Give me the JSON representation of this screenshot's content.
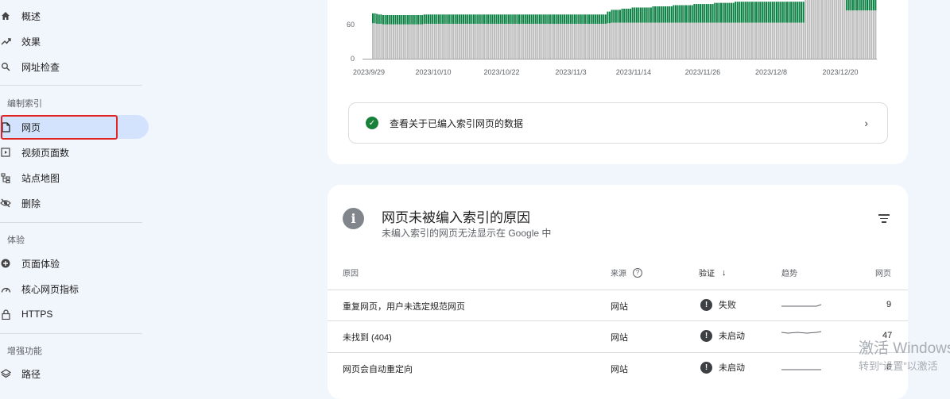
{
  "sidebar": {
    "items": [
      {
        "label": "概述",
        "icon": "home-icon"
      },
      {
        "label": "效果",
        "icon": "trending-icon"
      },
      {
        "label": "网址检查",
        "icon": "search-icon"
      }
    ],
    "sections": [
      {
        "label": "编制索引",
        "items": [
          {
            "label": "网页",
            "icon": "page-icon",
            "active": true
          },
          {
            "label": "视频页面数",
            "icon": "video-page-icon"
          },
          {
            "label": "站点地图",
            "icon": "sitemap-icon"
          },
          {
            "label": "删除",
            "icon": "hide-icon"
          }
        ]
      },
      {
        "label": "体验",
        "items": [
          {
            "label": "页面体验",
            "icon": "add-circle-icon"
          },
          {
            "label": "核心网页指标",
            "icon": "speed-icon"
          },
          {
            "label": "HTTPS",
            "icon": "lock-icon"
          }
        ]
      },
      {
        "label": "增强功能",
        "items": [
          {
            "label": "路径",
            "icon": "layers-icon"
          }
        ]
      }
    ]
  },
  "chart_data": {
    "type": "bar",
    "stacked": true,
    "y_ticks": [
      "60",
      "0"
    ],
    "x_ticks": [
      "2023/9/29",
      "2023/10/10",
      "2023/10/22",
      "2023/11/3",
      "2023/11/14",
      "2023/11/26",
      "2023/12/8",
      "2023/12/20"
    ],
    "series": [
      {
        "color": "#bdbdbd",
        "values": [
          61,
          61,
          60,
          60,
          60,
          59,
          59,
          59,
          59,
          59,
          59,
          59,
          59,
          59,
          59,
          59,
          59,
          59,
          59,
          59,
          59,
          59,
          59,
          59,
          59,
          60,
          60,
          60,
          60,
          60,
          60,
          60,
          60,
          60,
          60,
          60,
          60,
          60,
          60,
          60,
          60,
          60,
          60,
          60,
          60,
          60,
          60,
          60,
          60,
          60,
          60,
          60,
          60,
          60,
          60,
          60,
          60,
          60,
          60,
          60,
          60,
          60,
          60,
          60,
          60,
          60,
          60,
          60,
          60,
          60,
          60,
          60,
          60,
          60,
          60,
          60,
          60,
          60,
          60,
          60,
          60,
          60,
          60,
          60,
          60,
          60,
          60,
          60,
          60,
          60,
          60,
          60,
          60,
          60,
          60,
          60,
          60,
          60,
          60,
          60,
          60,
          60,
          60,
          60,
          60,
          60,
          60,
          60,
          60,
          60,
          60,
          60,
          60,
          60,
          61,
          61,
          62,
          62,
          62,
          62,
          62,
          62,
          62,
          62,
          62,
          62,
          62,
          62,
          62,
          62,
          62,
          62,
          62,
          62,
          62,
          62,
          62,
          62,
          62,
          62,
          62,
          62,
          62,
          62,
          62,
          62,
          62,
          62,
          62,
          62,
          62,
          62,
          62,
          62,
          62,
          62,
          62,
          62,
          62,
          62,
          62,
          62,
          62,
          62,
          62,
          62,
          62,
          62,
          62,
          62,
          62,
          62,
          62,
          62,
          62,
          62,
          62,
          62,
          62,
          62,
          62,
          62,
          62,
          62,
          62,
          62,
          62,
          62,
          62,
          62,
          62,
          62,
          62,
          62,
          62,
          62,
          62,
          62,
          62,
          62,
          62,
          62,
          62,
          62,
          62,
          62,
          62,
          62,
          62,
          62,
          110,
          110,
          110,
          110,
          110,
          110,
          110,
          110,
          110,
          110,
          110,
          110,
          110,
          110,
          110,
          110,
          110,
          110,
          110,
          110,
          83,
          83,
          83,
          83,
          83,
          83,
          83,
          83,
          83,
          83,
          83,
          83,
          83,
          83,
          83
        ]
      },
      {
        "color": "#0b8043",
        "values": [
          17,
          17,
          17,
          16,
          16,
          16,
          16,
          16,
          16,
          16,
          16,
          16,
          16,
          16,
          16,
          16,
          16,
          16,
          16,
          16,
          16,
          16,
          16,
          16,
          16,
          16,
          16,
          16,
          16,
          16,
          16,
          16,
          16,
          16,
          16,
          16,
          16,
          16,
          16,
          16,
          16,
          16,
          16,
          16,
          16,
          16,
          16,
          16,
          16,
          16,
          16,
          16,
          16,
          16,
          16,
          16,
          16,
          16,
          16,
          16,
          16,
          16,
          16,
          16,
          16,
          16,
          16,
          16,
          16,
          16,
          16,
          16,
          16,
          16,
          16,
          16,
          16,
          16,
          16,
          16,
          16,
          16,
          16,
          16,
          16,
          16,
          16,
          16,
          16,
          16,
          16,
          16,
          16,
          16,
          16,
          16,
          16,
          16,
          16,
          16,
          16,
          16,
          16,
          16,
          16,
          16,
          16,
          16,
          16,
          16,
          16,
          16,
          16,
          16,
          20,
          20,
          22,
          22,
          22,
          22,
          22,
          24,
          24,
          24,
          24,
          24,
          26,
          26,
          26,
          26,
          26,
          26,
          26,
          26,
          26,
          26,
          28,
          28,
          28,
          28,
          28,
          28,
          28,
          28,
          28,
          28,
          30,
          30,
          30,
          30,
          30,
          30,
          30,
          30,
          30,
          30,
          32,
          32,
          32,
          32,
          32,
          32,
          32,
          32,
          32,
          32,
          34,
          34,
          34,
          34,
          34,
          34,
          34,
          34,
          34,
          34,
          36,
          36,
          36,
          36,
          36,
          36,
          36,
          36,
          36,
          36,
          36,
          36,
          36,
          36,
          36,
          36,
          36,
          36,
          36,
          36,
          36,
          36,
          36,
          36,
          36,
          36,
          36,
          36,
          36,
          36,
          36,
          36,
          36,
          36,
          0,
          0,
          0,
          0,
          0,
          0,
          0,
          0,
          0,
          0,
          0,
          0,
          0,
          0,
          0,
          0,
          0,
          0,
          0,
          0,
          28,
          28,
          28,
          28,
          28,
          28,
          28,
          28,
          28,
          28,
          28,
          28,
          28,
          28,
          28
        ]
      }
    ]
  },
  "top_card": {
    "link_text": "查看关于已编入索引网页的数据"
  },
  "reasons": {
    "title": "网页未被编入索引的原因",
    "subtitle": "未编入索引的网页无法显示在 Google 中",
    "columns": {
      "reason": "原因",
      "source": "来源",
      "validation": "验证",
      "trend": "趋势",
      "pages": "网页"
    },
    "rows": [
      {
        "reason": "重复网页，用户未选定规范网页",
        "source": "网站",
        "status": "失败",
        "pages": "9"
      },
      {
        "reason": "未找到 (404)",
        "source": "网站",
        "status": "未启动",
        "pages": "47"
      },
      {
        "reason": "网页会自动重定向",
        "source": "网站",
        "status": "未启动",
        "pages": "6"
      }
    ]
  },
  "watermark": {
    "line1": "激活 Windows",
    "line2": "转到“设置”以激活"
  }
}
